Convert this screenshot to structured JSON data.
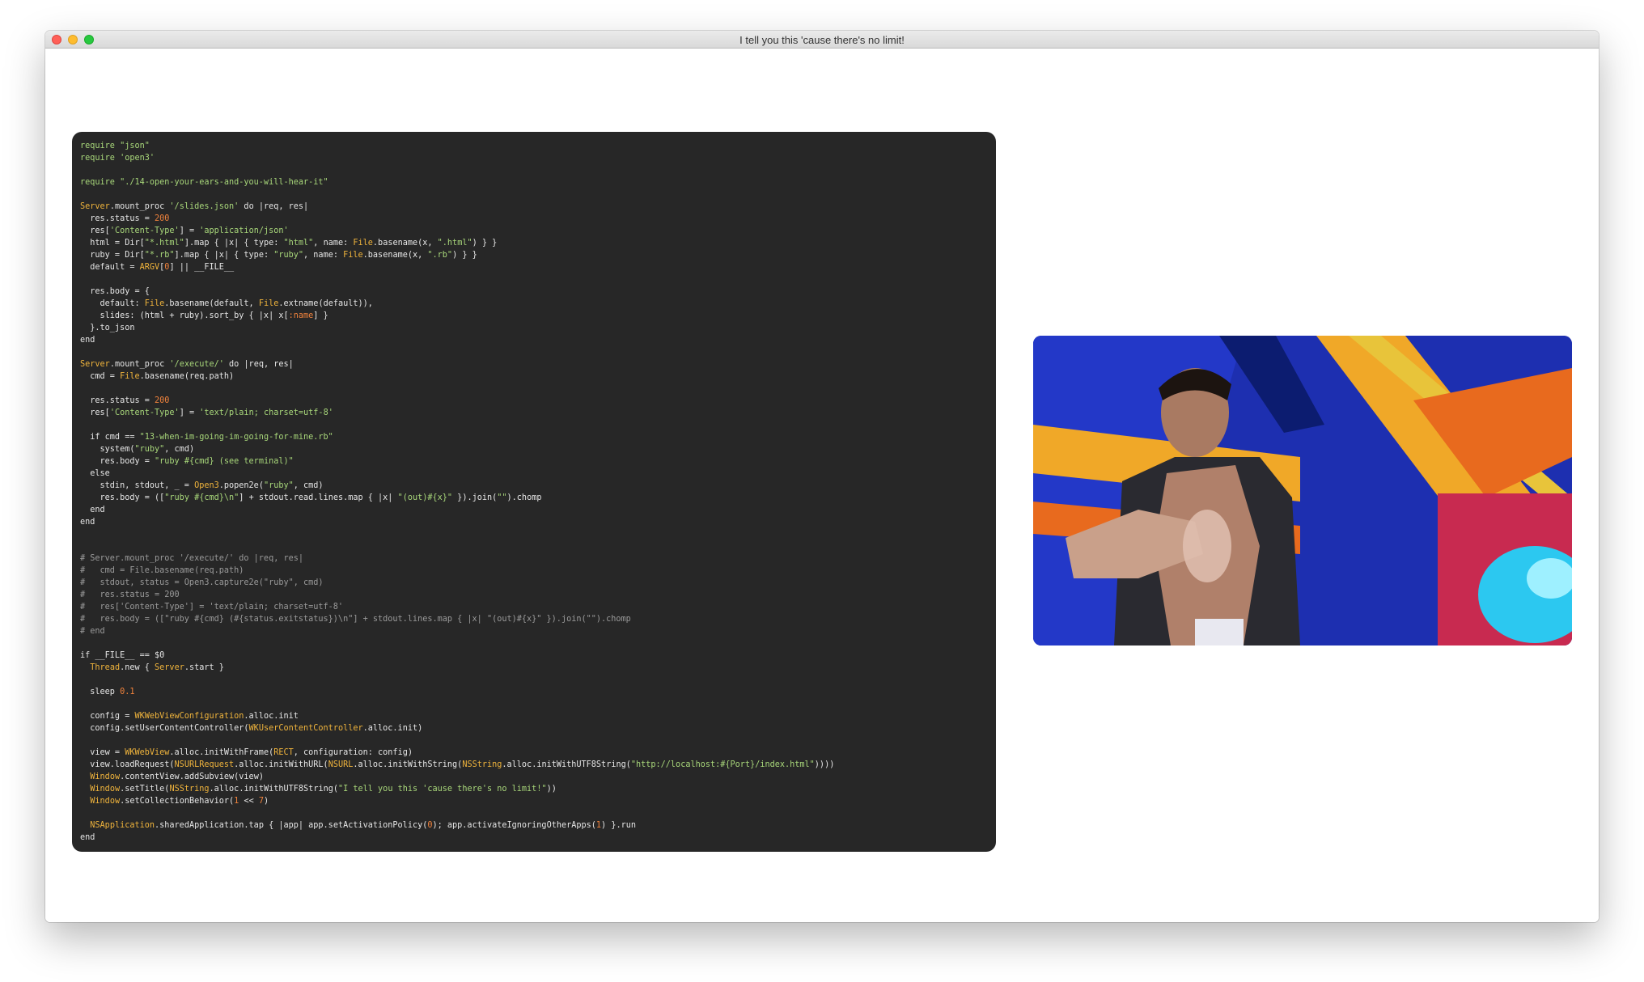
{
  "window": {
    "title": "I tell you this 'cause there's no limit!"
  },
  "colors": {
    "default": "#e6e6e6",
    "string": "#a8d77a",
    "constant": "#f0b43c",
    "number": "#f0823c",
    "comment": "#9a9a9a",
    "symbol": "#f0823c"
  },
  "code_lines": [
    [
      [
        "string",
        "require \"json\""
      ]
    ],
    [
      [
        "string",
        "require 'open3'"
      ]
    ],
    [
      [
        "default",
        ""
      ]
    ],
    [
      [
        "string",
        "require \"./14-open-your-ears-and-you-will-hear-it\""
      ]
    ],
    [
      [
        "default",
        ""
      ]
    ],
    [
      [
        "constant",
        "Server"
      ],
      [
        "default",
        ".mount_proc "
      ],
      [
        "string",
        "'/slides.json'"
      ],
      [
        "default",
        " do |req, res|"
      ]
    ],
    [
      [
        "default",
        "  res.status = "
      ],
      [
        "number",
        "200"
      ]
    ],
    [
      [
        "default",
        "  res["
      ],
      [
        "string",
        "'Content-Type'"
      ],
      [
        "default",
        "] = "
      ],
      [
        "string",
        "'application/json'"
      ]
    ],
    [
      [
        "default",
        "  html = Dir["
      ],
      [
        "string",
        "\"*.html\""
      ],
      [
        "default",
        "].map { |x| { type: "
      ],
      [
        "string",
        "\"html\""
      ],
      [
        "default",
        ", name: "
      ],
      [
        "constant",
        "File"
      ],
      [
        "default",
        ".basename(x, "
      ],
      [
        "string",
        "\".html\""
      ],
      [
        "default",
        ") } }"
      ]
    ],
    [
      [
        "default",
        "  ruby = Dir["
      ],
      [
        "string",
        "\"*.rb\""
      ],
      [
        "default",
        "].map { |x| { type: "
      ],
      [
        "string",
        "\"ruby\""
      ],
      [
        "default",
        ", name: "
      ],
      [
        "constant",
        "File"
      ],
      [
        "default",
        ".basename(x, "
      ],
      [
        "string",
        "\".rb\""
      ],
      [
        "default",
        ") } }"
      ]
    ],
    [
      [
        "default",
        "  default = "
      ],
      [
        "constant",
        "ARGV"
      ],
      [
        "default",
        "["
      ],
      [
        "number",
        "0"
      ],
      [
        "default",
        "] || __FILE__"
      ]
    ],
    [
      [
        "default",
        ""
      ]
    ],
    [
      [
        "default",
        "  res.body = {"
      ]
    ],
    [
      [
        "default",
        "    default: "
      ],
      [
        "constant",
        "File"
      ],
      [
        "default",
        ".basename(default, "
      ],
      [
        "constant",
        "File"
      ],
      [
        "default",
        ".extname(default)),"
      ]
    ],
    [
      [
        "default",
        "    slides: (html + ruby).sort_by { |x| x["
      ],
      [
        "symbol",
        ":name"
      ],
      [
        "default",
        "] }"
      ]
    ],
    [
      [
        "default",
        "  }.to_json"
      ]
    ],
    [
      [
        "default",
        "end"
      ]
    ],
    [
      [
        "default",
        ""
      ]
    ],
    [
      [
        "constant",
        "Server"
      ],
      [
        "default",
        ".mount_proc "
      ],
      [
        "string",
        "'/execute/'"
      ],
      [
        "default",
        " do |req, res|"
      ]
    ],
    [
      [
        "default",
        "  cmd = "
      ],
      [
        "constant",
        "File"
      ],
      [
        "default",
        ".basename(req.path)"
      ]
    ],
    [
      [
        "default",
        ""
      ]
    ],
    [
      [
        "default",
        "  res.status = "
      ],
      [
        "number",
        "200"
      ]
    ],
    [
      [
        "default",
        "  res["
      ],
      [
        "string",
        "'Content-Type'"
      ],
      [
        "default",
        "] = "
      ],
      [
        "string",
        "'text/plain; charset=utf-8'"
      ]
    ],
    [
      [
        "default",
        ""
      ]
    ],
    [
      [
        "default",
        "  if cmd == "
      ],
      [
        "string",
        "\"13-when-im-going-im-going-for-mine.rb\""
      ]
    ],
    [
      [
        "default",
        "    system("
      ],
      [
        "string",
        "\"ruby\""
      ],
      [
        "default",
        ", cmd)"
      ]
    ],
    [
      [
        "default",
        "    res.body = "
      ],
      [
        "string",
        "\"ruby #{cmd} (see terminal)\""
      ]
    ],
    [
      [
        "default",
        "  else"
      ]
    ],
    [
      [
        "default",
        "    stdin, stdout, _ = "
      ],
      [
        "constant",
        "Open3"
      ],
      [
        "default",
        ".popen2e("
      ],
      [
        "string",
        "\"ruby\""
      ],
      [
        "default",
        ", cmd)"
      ]
    ],
    [
      [
        "default",
        "    res.body = (["
      ],
      [
        "string",
        "\"ruby #{cmd}\\n\""
      ],
      [
        "default",
        "] + stdout.read.lines.map { |x| "
      ],
      [
        "string",
        "\"(out)#{x}\""
      ],
      [
        "default",
        " }).join("
      ],
      [
        "string",
        "\"\""
      ],
      [
        "default",
        ").chomp"
      ]
    ],
    [
      [
        "default",
        "  end"
      ]
    ],
    [
      [
        "default",
        "end"
      ]
    ],
    [
      [
        "default",
        ""
      ]
    ],
    [
      [
        "default",
        ""
      ]
    ],
    [
      [
        "comment",
        "# Server.mount_proc '/execute/' do |req, res|"
      ]
    ],
    [
      [
        "comment",
        "#   cmd = File.basename(req.path)"
      ]
    ],
    [
      [
        "comment",
        "#   stdout, status = Open3.capture2e(\"ruby\", cmd)"
      ]
    ],
    [
      [
        "comment",
        "#   res.status = 200"
      ]
    ],
    [
      [
        "comment",
        "#   res['Content-Type'] = 'text/plain; charset=utf-8'"
      ]
    ],
    [
      [
        "comment",
        "#   res.body = ([\"ruby #{cmd} (#{status.exitstatus})\\n\"] + stdout.lines.map { |x| \"(out)#{x}\" }).join(\"\").chomp"
      ]
    ],
    [
      [
        "comment",
        "# end"
      ]
    ],
    [
      [
        "default",
        ""
      ]
    ],
    [
      [
        "default",
        "if __FILE__ == $0"
      ]
    ],
    [
      [
        "default",
        "  "
      ],
      [
        "constant",
        "Thread"
      ],
      [
        "default",
        ".new { "
      ],
      [
        "constant",
        "Server"
      ],
      [
        "default",
        ".start }"
      ]
    ],
    [
      [
        "default",
        ""
      ]
    ],
    [
      [
        "default",
        "  sleep "
      ],
      [
        "number",
        "0.1"
      ]
    ],
    [
      [
        "default",
        ""
      ]
    ],
    [
      [
        "default",
        "  config = "
      ],
      [
        "constant",
        "WKWebViewConfiguration"
      ],
      [
        "default",
        ".alloc.init"
      ]
    ],
    [
      [
        "default",
        "  config.setUserContentController("
      ],
      [
        "constant",
        "WKUserContentController"
      ],
      [
        "default",
        ".alloc.init)"
      ]
    ],
    [
      [
        "default",
        ""
      ]
    ],
    [
      [
        "default",
        "  view = "
      ],
      [
        "constant",
        "WKWebView"
      ],
      [
        "default",
        ".alloc.initWithFrame("
      ],
      [
        "constant",
        "RECT"
      ],
      [
        "default",
        ", configuration: config)"
      ]
    ],
    [
      [
        "default",
        "  view.loadRequest("
      ],
      [
        "constant",
        "NSURLRequest"
      ],
      [
        "default",
        ".alloc.initWithURL("
      ],
      [
        "constant",
        "NSURL"
      ],
      [
        "default",
        ".alloc.initWithString("
      ],
      [
        "constant",
        "NSString"
      ],
      [
        "default",
        ".alloc.initWithUTF8String("
      ],
      [
        "string",
        "\"http://localhost:#{Port}/index.html\""
      ],
      [
        "default",
        "))))"
      ]
    ],
    [
      [
        "default",
        "  "
      ],
      [
        "constant",
        "Window"
      ],
      [
        "default",
        ".contentView.addSubview(view)"
      ]
    ],
    [
      [
        "default",
        "  "
      ],
      [
        "constant",
        "Window"
      ],
      [
        "default",
        ".setTitle("
      ],
      [
        "constant",
        "NSString"
      ],
      [
        "default",
        ".alloc.initWithUTF8String("
      ],
      [
        "string",
        "\"I tell you this 'cause there's no limit!\""
      ],
      [
        "default",
        "))"
      ]
    ],
    [
      [
        "default",
        "  "
      ],
      [
        "constant",
        "Window"
      ],
      [
        "default",
        ".setCollectionBehavior("
      ],
      [
        "number",
        "1"
      ],
      [
        "default",
        " << "
      ],
      [
        "number",
        "7"
      ],
      [
        "default",
        ")"
      ]
    ],
    [
      [
        "default",
        ""
      ]
    ],
    [
      [
        "default",
        "  "
      ],
      [
        "constant",
        "NSApplication"
      ],
      [
        "default",
        ".sharedApplication.tap { |app| app.setActivationPolicy("
      ],
      [
        "number",
        "0"
      ],
      [
        "default",
        "); app.activateIgnoringOtherApps("
      ],
      [
        "number",
        "1"
      ],
      [
        "default",
        ") }.run"
      ]
    ],
    [
      [
        "default",
        "end"
      ]
    ]
  ]
}
